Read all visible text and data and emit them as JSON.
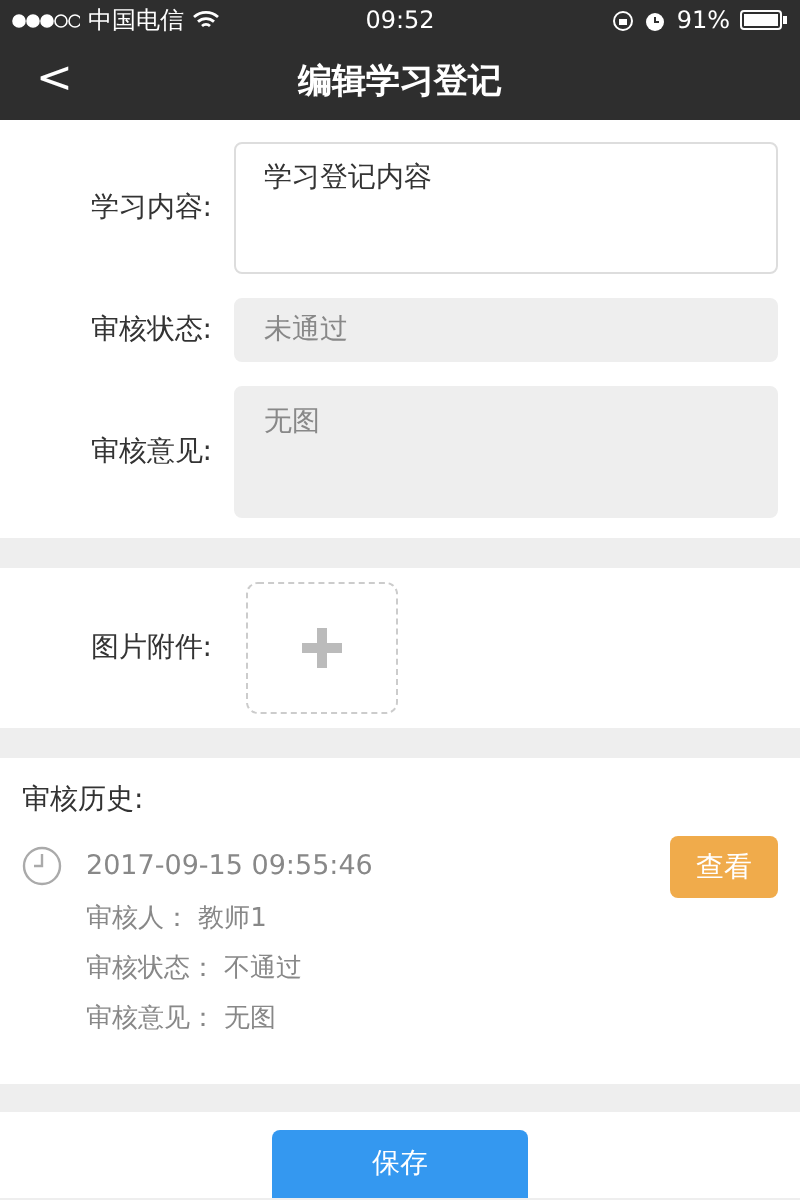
{
  "status_bar": {
    "carrier": "中国电信",
    "time": "09:52",
    "battery": "91%"
  },
  "nav": {
    "back": "<",
    "title": "编辑学习登记"
  },
  "form": [
    {
      "kind": "textarea",
      "label": "学习内容:",
      "value": "学习登记内容",
      "disabled": false
    },
    {
      "kind": "input",
      "label": "审核状态:",
      "value": "未通过",
      "disabled": true
    },
    {
      "kind": "textarea",
      "label": "审核意见:",
      "value": "无图",
      "disabled": true
    }
  ],
  "attachments": {
    "label": "图片附件:"
  },
  "history": {
    "title": "审核历史:",
    "entries": [
      {
        "time": "2017-09-15 09:55:46",
        "lines": [
          "审核人： 教师1",
          "审核状态： 不通过",
          "审核意见： 无图"
        ],
        "button": "查看"
      }
    ]
  },
  "save_button": "保存"
}
